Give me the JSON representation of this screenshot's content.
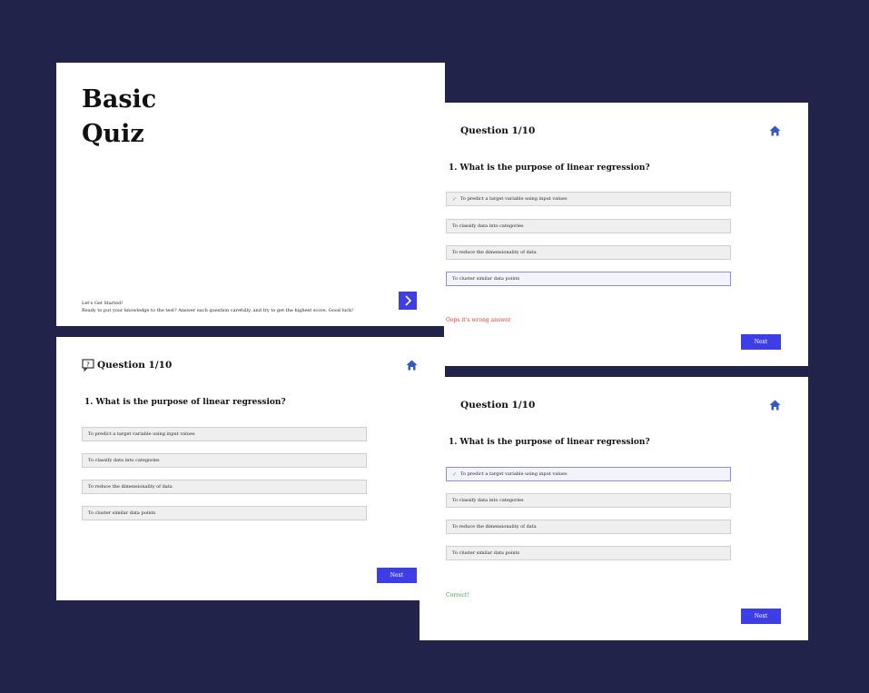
{
  "title_card": {
    "title_line1": "Basic",
    "title_line2": "Quiz",
    "subtitle": "Let's Get Started!",
    "description": "Ready to put your knowledge to the test? Answer each question carefully, and try to get the highest score. Good luck!",
    "start_icon": "chevron-right-icon"
  },
  "quiz": {
    "question_label": "Question 1/10",
    "question": "1. What is the purpose of linear regression?",
    "options": [
      "To predict a target variable using input values",
      "To classify data into categories",
      "To reduce the dimensionality of data",
      "To cluster similar data points"
    ],
    "next_label": "Next",
    "home_icon": "home-icon",
    "question_icon": "chat-question-icon"
  },
  "feedback": {
    "wrong": "Oops it's wrong answer",
    "correct": "Correct!"
  },
  "colors": {
    "background": "#22234a",
    "accent": "#3e3ee6",
    "wrong": "#e53935",
    "correct": "#43a047"
  }
}
